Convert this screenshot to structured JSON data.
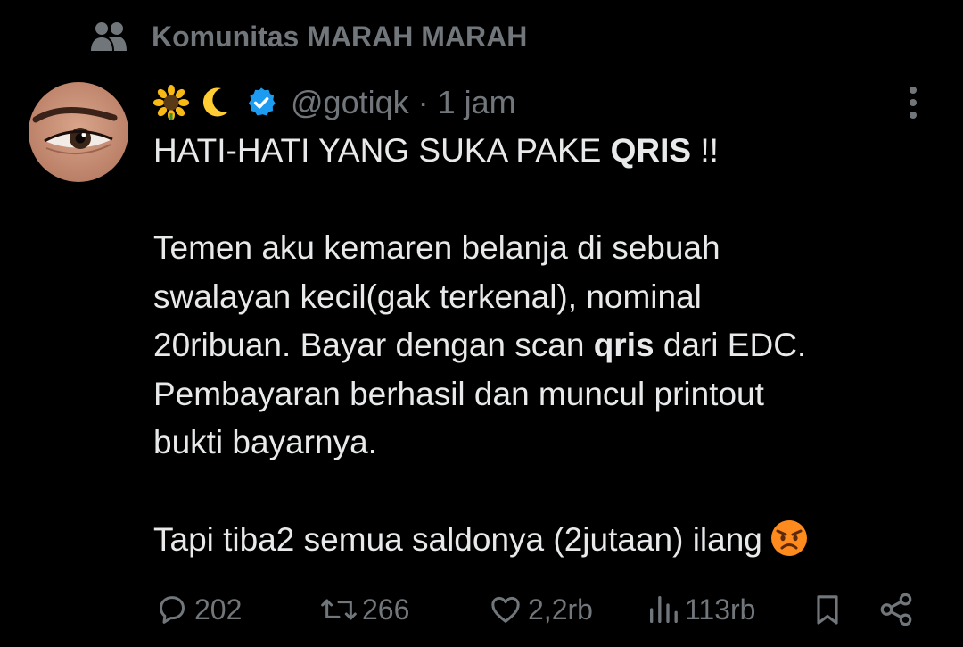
{
  "community": {
    "icon": "community-icon",
    "label": "Komunitas MARAH MARAH"
  },
  "author": {
    "avatar": "avatar",
    "display_emojis": [
      "sunflower-emoji",
      "crescent-moon-emoji"
    ],
    "verified": true,
    "handle": "@gotiqk",
    "separator": "·",
    "time": "1 jam"
  },
  "tweet": {
    "paragraphs": [
      [
        {
          "text": "HATI-HATI YANG SUKA PAKE ",
          "bold": false
        },
        {
          "text": "QRIS",
          "bold": true
        },
        {
          "text": " !!",
          "bold": false
        }
      ],
      [],
      [
        {
          "text": "Temen aku kemaren belanja di sebuah",
          "bold": false,
          "br": true
        },
        {
          "text": "swalayan kecil(gak terkenal), nominal",
          "bold": false,
          "br": true
        },
        {
          "text": "20ribuan. Bayar dengan scan ",
          "bold": false
        },
        {
          "text": "qris",
          "bold": true
        },
        {
          "text": " dari EDC.",
          "bold": false,
          "br": true
        },
        {
          "text": "Pembayaran berhasil dan muncul printout",
          "bold": false,
          "br": true
        },
        {
          "text": "bukti bayarnya.",
          "bold": false
        }
      ],
      [],
      [
        {
          "text": "Tapi tiba2 semua saldonya (2jutaan) ilang",
          "bold": false
        },
        {
          "emoji": "angry-face-emoji"
        }
      ]
    ]
  },
  "actions": {
    "reply": {
      "icon": "reply-icon",
      "count": "202"
    },
    "repost": {
      "icon": "repost-icon",
      "count": "266"
    },
    "like": {
      "icon": "heart-icon",
      "count": "2,2rb"
    },
    "views": {
      "icon": "views-icon",
      "count": "113rb"
    },
    "bookmark": {
      "icon": "bookmark-icon"
    },
    "share": {
      "icon": "share-icon"
    }
  },
  "colors": {
    "background": "#000000",
    "text": "#e7e9ea",
    "muted": "#71767b",
    "verified": "#1d9bf0"
  }
}
